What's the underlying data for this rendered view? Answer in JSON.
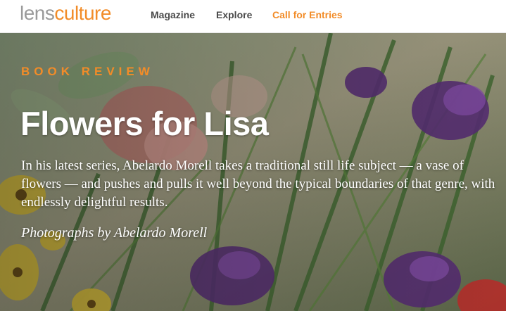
{
  "header": {
    "logo": {
      "part1": "lens",
      "part2": "culture"
    },
    "nav": [
      {
        "label": "Magazine"
      },
      {
        "label": "Explore"
      },
      {
        "label": "Call for Entries"
      }
    ]
  },
  "hero": {
    "kicker": "BOOK REVIEW",
    "title": "Flowers for Lisa",
    "description": "In his latest series, Abelardo Morell takes a traditional still life subject — a vase of flowers — and pushes and pulls it well beyond the typical boundaries of that genre, with endlessly delightful results.",
    "credit": "Photographs by Abelardo Morell"
  },
  "colors": {
    "accent": "#f28c28",
    "nav_text": "#4a4a4a",
    "logo_gray": "#9a9a9a"
  }
}
